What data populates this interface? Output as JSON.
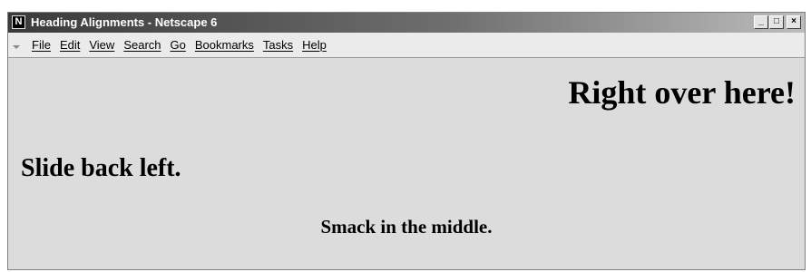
{
  "window": {
    "title": "Heading Alignments - Netscape 6",
    "app_icon": "N",
    "controls": {
      "minimize": "_",
      "maximize": "□",
      "close": "×"
    }
  },
  "menubar": {
    "items": [
      {
        "label": "File"
      },
      {
        "label": "Edit"
      },
      {
        "label": "View"
      },
      {
        "label": "Search"
      },
      {
        "label": "Go"
      },
      {
        "label": "Bookmarks"
      },
      {
        "label": "Tasks"
      },
      {
        "label": "Help"
      }
    ]
  },
  "content": {
    "right_heading": "Right over here!",
    "left_heading": "Slide back left.",
    "center_heading": "Smack in the middle."
  }
}
